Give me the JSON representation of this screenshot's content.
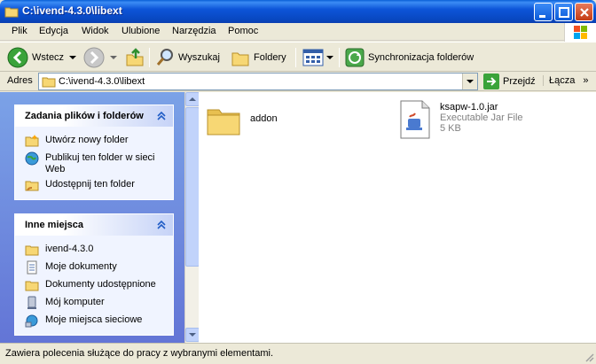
{
  "window": {
    "title": "C:\\ivend-4.3.0\\libext"
  },
  "menu": [
    {
      "label": "Plik"
    },
    {
      "label": "Edycja"
    },
    {
      "label": "Widok"
    },
    {
      "label": "Ulubione"
    },
    {
      "label": "Narzędzia"
    },
    {
      "label": "Pomoc"
    }
  ],
  "toolbar": {
    "back": "Wstecz",
    "search": "Wyszukaj",
    "folders": "Foldery",
    "sync": "Synchronizacja folderów"
  },
  "address": {
    "label": "Adres",
    "path": "C:\\ivend-4.3.0\\libext",
    "go": "Przejdź",
    "links": "Łącza"
  },
  "tasks_panel": {
    "title": "Zadania plików i folderów",
    "items": [
      {
        "label": "Utwórz nowy folder"
      },
      {
        "label": "Publikuj ten folder w sieci Web"
      },
      {
        "label": "Udostępnij ten folder"
      }
    ]
  },
  "places_panel": {
    "title": "Inne miejsca",
    "items": [
      {
        "label": "ivend-4.3.0"
      },
      {
        "label": "Moje dokumenty"
      },
      {
        "label": "Dokumenty udostępnione"
      },
      {
        "label": "Mój komputer"
      },
      {
        "label": "Moje miejsca sieciowe"
      }
    ]
  },
  "files": [
    {
      "name": "addon",
      "type": "folder"
    },
    {
      "name": "ksapw-1.0.jar",
      "kind": "Executable Jar File",
      "size": "5 KB",
      "type": "jar"
    }
  ],
  "status": {
    "text": "Zawiera polecenia służące do pracy z wybranymi elementami."
  }
}
